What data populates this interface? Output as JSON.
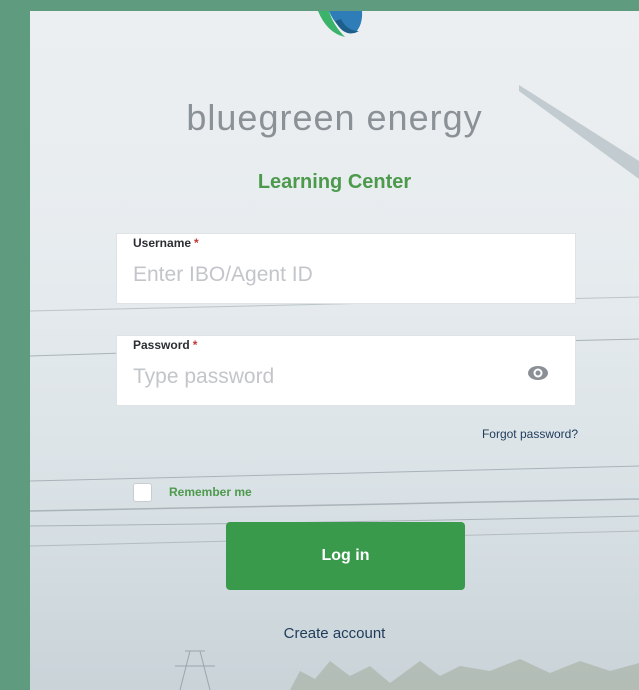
{
  "brand": {
    "name": "bluegreen energy",
    "subtitle": "Learning Center",
    "logo_colors": [
      "#2e7db8",
      "#3bb36a",
      "#1d5f8a"
    ]
  },
  "form": {
    "username": {
      "label": "Username",
      "required_mark": "*",
      "placeholder": "Enter IBO/Agent ID",
      "value": ""
    },
    "password": {
      "label": "Password",
      "required_mark": "*",
      "placeholder": "Type password",
      "value": "",
      "toggle_icon": "eye-icon"
    },
    "forgot_link": "Forgot password?",
    "remember_me": {
      "label": "Remember me",
      "checked": false
    },
    "login_button": "Log in",
    "create_account_link": "Create account"
  },
  "colors": {
    "outer_background": "#5f9c7f",
    "accent_green": "#3a9a4c",
    "subtitle_green": "#4d9a4d",
    "link_navy": "#1f3b5a",
    "required_red": "#c23934"
  }
}
